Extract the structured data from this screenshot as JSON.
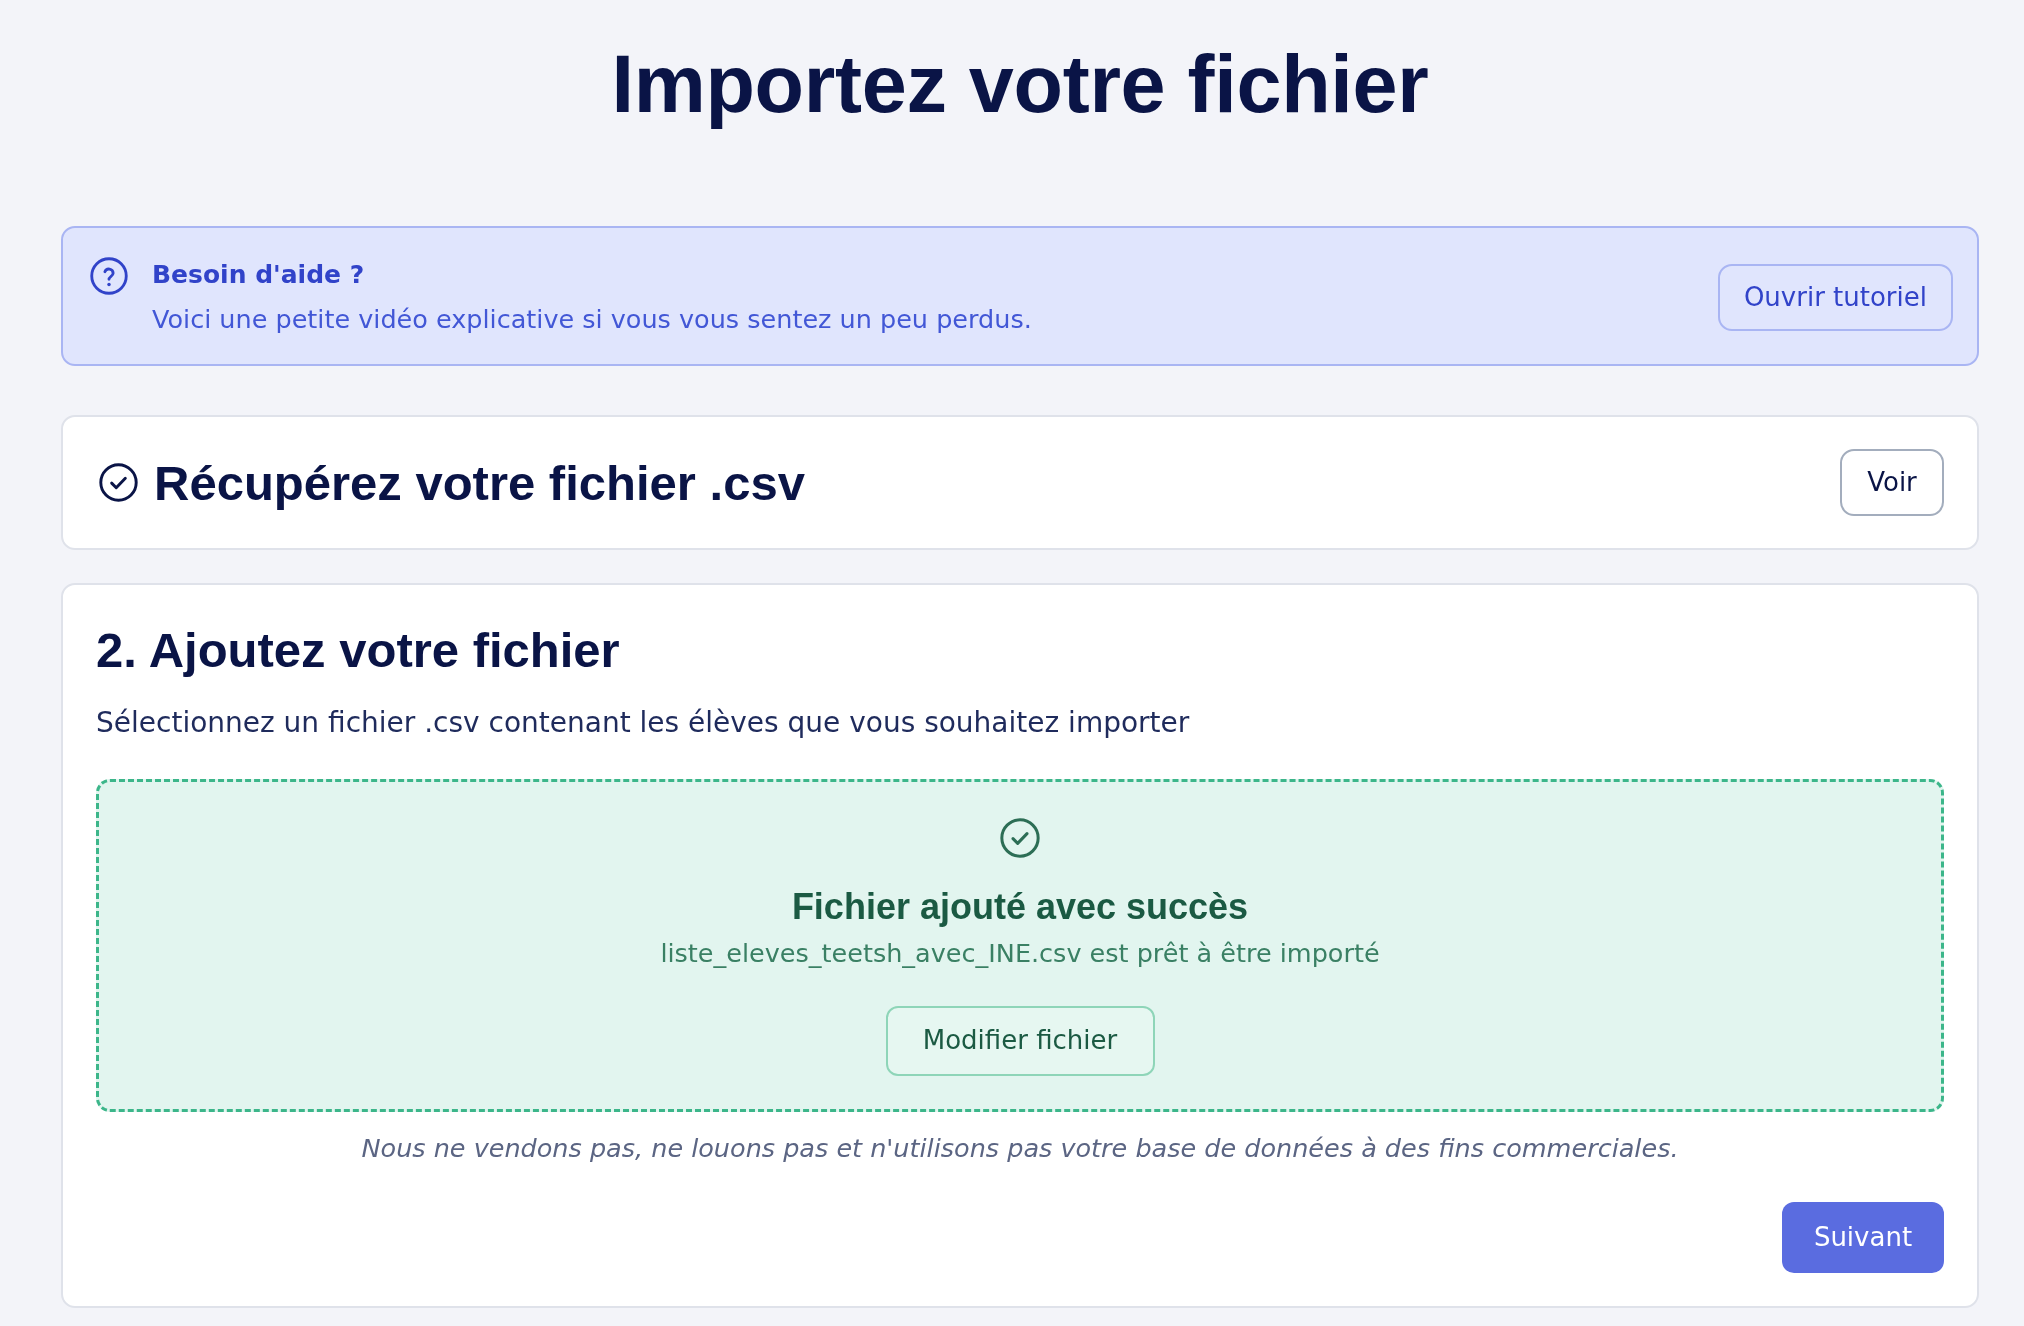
{
  "page_title": "Importez votre fichier",
  "help_banner": {
    "title": "Besoin d'aide ?",
    "text": "Voici une petite vidéo explicative si vous vous sentez un peu perdus.",
    "button": "Ouvrir tutoriel"
  },
  "steps": [
    {
      "kind": "summary",
      "completed": true,
      "title": "Récupérez votre fichier .csv",
      "button": "Voir"
    },
    {
      "kind": "form",
      "title": "2. Ajoutez votre fichier",
      "description": "Sélectionnez un fichier .csv contenant les élèves que vous souhaitez importer",
      "upload": {
        "succeeded": true,
        "title": "Fichier ajouté avec succès",
        "message": "liste_eleves_teetsh_avec_INE.csv est prêt à être importé",
        "button": "Modifier fichier"
      },
      "notice": "Nous ne vendons pas, ne louons pas et n'utilisons pas votre base de données à des fins commerciales.",
      "next_button": "Suivant"
    }
  ]
}
